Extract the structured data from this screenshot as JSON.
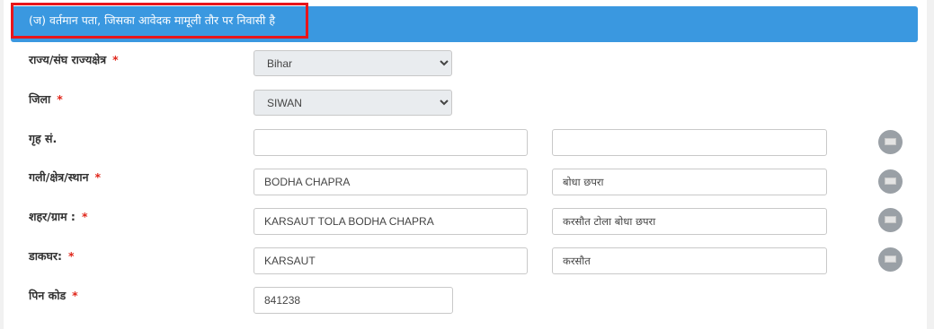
{
  "section": {
    "title": "(ज) वर्तमान पता, जिसका आवेदक मामूली तौर पर निवासी है"
  },
  "required_mark": "*",
  "fields": {
    "state": {
      "label": "राज्य/संघ राज्यक्षेत्र",
      "value": "Bihar"
    },
    "district": {
      "label": "जिला",
      "value": "SIWAN"
    },
    "house": {
      "label": "गृह सं.",
      "value_en": "",
      "value_hi": ""
    },
    "street": {
      "label": "गली/क्षेत्र/स्थान",
      "value_en": "BODHA CHAPRA",
      "value_hi": "बोधा छपरा"
    },
    "city": {
      "label": "शहर/ग्राम :",
      "value_en": "KARSAUT TOLA BODHA CHAPRA",
      "value_hi": "करसौत टोला बोधा छपरा"
    },
    "post_office": {
      "label": "डाकघर:",
      "value_en": "KARSAUT",
      "value_hi": "करसौत"
    },
    "pin": {
      "label": "पिन कोड",
      "value": "841238"
    }
  },
  "icons": {
    "keyboard": "keyboard-icon"
  },
  "colors": {
    "header": "#3a98e0",
    "highlight": "#e8151b",
    "required": "#e0261a"
  }
}
